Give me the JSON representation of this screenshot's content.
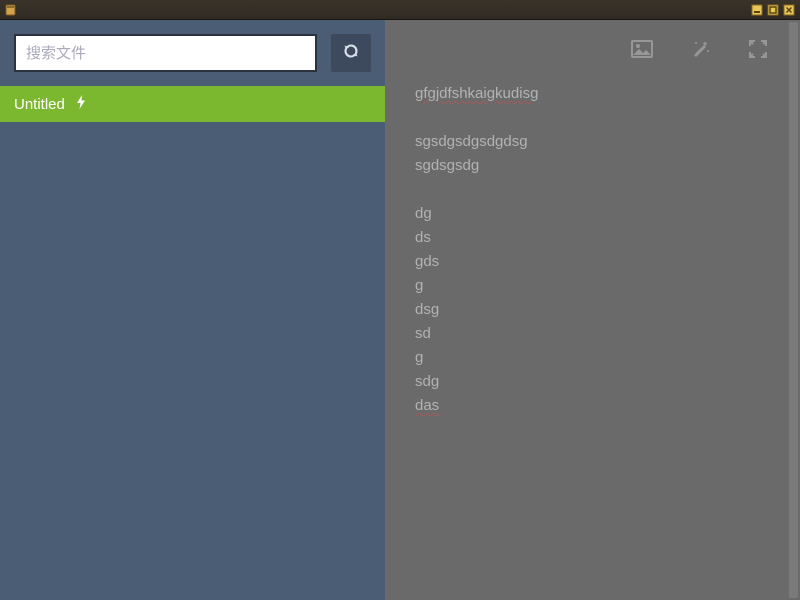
{
  "titlebar": {
    "title": ""
  },
  "search": {
    "placeholder": "搜索文件",
    "value": ""
  },
  "files": [
    {
      "label": "Untitled",
      "active": true
    }
  ],
  "editor": {
    "lines": [
      {
        "text": "gfgjdfshkaigkudisg",
        "wavy": true
      },
      {
        "text": "",
        "wavy": false
      },
      {
        "text": "sgsdgsdgsdgdsg",
        "wavy": false
      },
      {
        "text": "sgdsgsdg",
        "wavy": false
      },
      {
        "text": "",
        "wavy": false
      },
      {
        "text": "dg",
        "wavy": false
      },
      {
        "text": "ds",
        "wavy": false
      },
      {
        "text": "gds",
        "wavy": false
      },
      {
        "text": "g",
        "wavy": false
      },
      {
        "text": "dsg",
        "wavy": false
      },
      {
        "text": "sd",
        "wavy": false
      },
      {
        "text": "g",
        "wavy": false
      },
      {
        "text": "sdg",
        "wavy": false
      },
      {
        "text": "das",
        "wavy": true
      }
    ]
  },
  "icons": {
    "refresh": "refresh",
    "image": "image",
    "wand": "magic-wand",
    "expand": "expand"
  }
}
